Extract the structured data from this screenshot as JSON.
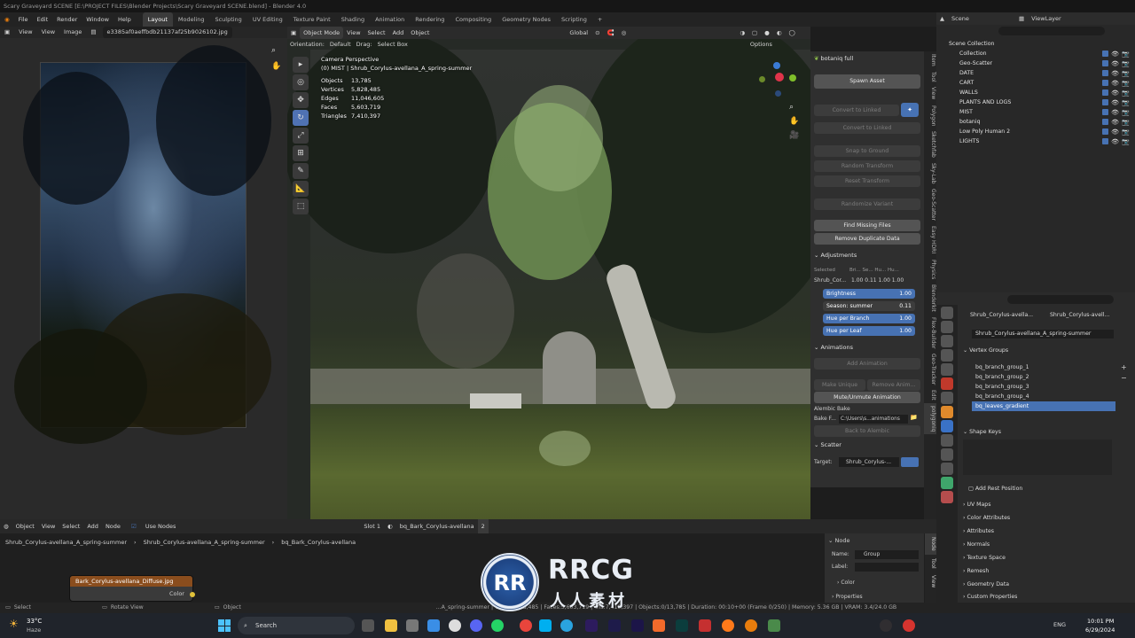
{
  "window": {
    "title": "Scary Graveyard SCENE [E:\\PROJECT FILES\\Blender Projects\\Scary Graveyard SCENE.blend] - Blender 4.0"
  },
  "menu": [
    "File",
    "Edit",
    "Render",
    "Window",
    "Help"
  ],
  "workspaces": [
    "Layout",
    "Modeling",
    "Sculpting",
    "UV Editing",
    "Texture Paint",
    "Shading",
    "Animation",
    "Rendering",
    "Compositing",
    "Geometry Nodes",
    "Scripting"
  ],
  "image_editor": {
    "menu": [
      "View",
      "View",
      "Image"
    ],
    "image_name": "e3385af0aeffbdb21137af25b9026102.jpg"
  },
  "viewport": {
    "header": [
      "Object Mode",
      "View",
      "Select",
      "Add",
      "Object"
    ],
    "transform": "Global",
    "orientation_label": "Orientation:",
    "orientation_value": "Default",
    "drag_label": "Drag:",
    "drag_value": "Select Box",
    "options": "Options",
    "camera_line": "Camera Perspective",
    "object_line": "(0) MIST | Shrub_Corylus-avellana_A_spring-summer",
    "stats": [
      {
        "label": "Objects",
        "value": "13,785"
      },
      {
        "label": "Vertices",
        "value": "5,828,485"
      },
      {
        "label": "Edges",
        "value": "11,046,605"
      },
      {
        "label": "Faces",
        "value": "5,603,719"
      },
      {
        "label": "Triangles",
        "value": "7,410,397"
      }
    ],
    "tools": [
      "▸",
      "◎",
      "✥",
      "↻",
      "⤢",
      "⊞",
      "✎",
      "📐",
      "⬚"
    ]
  },
  "botaniq": {
    "title": "botaniq full",
    "spawn": "Spawn Asset",
    "convert_linked": "Convert to Linked",
    "convert_unlinked": "Convert to Linked",
    "snap": "Snap to Ground",
    "random_transform": "Random Transform",
    "reset_transform": "Reset Transform",
    "randomize_variant": "Randomize Variant",
    "find_missing": "Find Missing Files",
    "remove_duplicate": "Remove Duplicate Data",
    "adjustments_title": "Adjustments",
    "selected_label": "Selected",
    "selected_cols": "Bri... Se... Hu... Hu...",
    "selected_row_name": "Shrub_Cor...",
    "selected_row_vals": "1.00  0.11  1.00  1.00",
    "sliders": [
      {
        "label": "Brightness",
        "value": "1.00"
      },
      {
        "label": "Season: summer",
        "value": "0.11"
      },
      {
        "label": "Hue per Branch",
        "value": "1.00"
      },
      {
        "label": "Hue per Leaf",
        "value": "1.00"
      }
    ],
    "animations_title": "Animations",
    "add_animation": "Add Animation",
    "make_unique": "Make Unique",
    "remove_anim": "Remove Anim...",
    "mute": "Mute/Unmute Animation",
    "alembic_label": "Alembic Bake",
    "bake_label": "Bake F...",
    "bake_path": "C:\\Users\\s...animations",
    "back_alembic": "Back to Alembic",
    "scatter_title": "Scatter",
    "target_label": "Target:",
    "target_value": "Shrub_Corylus-..."
  },
  "npanel_tabs": [
    "Item",
    "Tool",
    "View",
    "Polygon",
    "Sketchfab",
    "Sky-Lab",
    "Geo-Scatter",
    "Easy HDRI",
    "Physics",
    "Blenderkit",
    "Flex-Builder",
    "Geo-Tracker",
    "Edit",
    "polygoniq"
  ],
  "outliner": {
    "title": "Scene",
    "view_layer": "ViewLayer",
    "rows": [
      {
        "name": "Scene Collection",
        "indent": 0
      },
      {
        "name": "Collection",
        "indent": 1
      },
      {
        "name": "Geo-Scatter",
        "indent": 1
      },
      {
        "name": "DATE",
        "indent": 1
      },
      {
        "name": "CART",
        "indent": 1
      },
      {
        "name": "WALLS",
        "indent": 1
      },
      {
        "name": "PLANTS AND LOGS",
        "indent": 1
      },
      {
        "name": "MIST",
        "indent": 1
      },
      {
        "name": "botaniq",
        "indent": 1
      },
      {
        "name": "Low Poly Human 2",
        "indent": 1
      },
      {
        "name": "LIGHTS",
        "indent": 1
      }
    ]
  },
  "properties": {
    "crumb_object": "Shrub_Corylus-avella...",
    "crumb_data": "Shrub_Corylus-avell...",
    "mesh_name": "Shrub_Corylus-avellana_A_spring-summer",
    "vertex_groups_title": "Vertex Groups",
    "vertex_groups": [
      "bq_branch_group_1",
      "bq_branch_group_2",
      "bq_branch_group_3",
      "bq_branch_group_4",
      "bq_leaves_gradient"
    ],
    "shape_keys_title": "Shape Keys",
    "add_rest": "Add Rest Position",
    "sections": [
      "UV Maps",
      "Color Attributes",
      "Attributes",
      "Normals",
      "Texture Space",
      "Remesh",
      "Geometry Data",
      "Custom Properties"
    ]
  },
  "node_editor": {
    "header": [
      "Object",
      "View",
      "Select",
      "Add",
      "Node"
    ],
    "use_nodes": "Use Nodes",
    "slot": "Slot 1",
    "material": "bq_Bark_Corylus-avellana",
    "material_users": "2",
    "breadcrumb": [
      "Shrub_Corylus-avellana_A_spring-summer",
      "Shrub_Corylus-avellana_A_spring-summer",
      "bq_Bark_Corylus-avellana"
    ],
    "node_title": "Bark_Corylus-avellana_Diffuse.jpg",
    "node_output": "Color",
    "panel_title": "Node",
    "name_label": "Name:",
    "name_value": "Group",
    "label_label": "Label:",
    "color_section": "Color",
    "properties_section": "Properties",
    "side_tabs": [
      "Node",
      "Tool",
      "View"
    ]
  },
  "statusbar": {
    "left": "Select",
    "mid": "Rotate View",
    "right": "Object",
    "info": "...A_spring-summer | Verts:5,828,485 | Faces:5,603,719 | Tris:7,410,397 | Objects:0/13,785 | Duration: 00:10+00 (Frame 0/250) | Memory: 5.36 GB | VRAM: 3.4/24.0 GB | 4.0.2"
  },
  "taskbar": {
    "weather_temp": "33°C",
    "weather_desc": "Haze",
    "search": "Search",
    "time": "10:01 PM",
    "date": "6/29/2024",
    "lang": "ENG"
  },
  "watermark": {
    "logo_text": "RR",
    "title": "RRCG",
    "subtitle": "人人素材"
  },
  "colors": {
    "accent": "#4772b3",
    "node_header": "#8a4d1d"
  }
}
